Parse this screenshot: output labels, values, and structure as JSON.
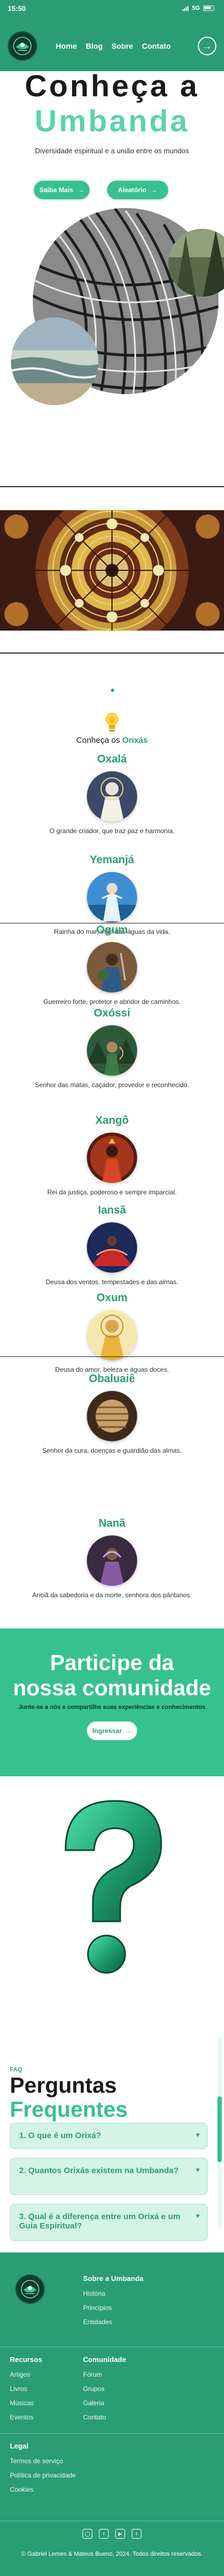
{
  "status_bar": {
    "time": "15:50",
    "network": "5G"
  },
  "header": {
    "nav": [
      "Home",
      "Blog",
      "Sobre",
      "Contato"
    ]
  },
  "hero": {
    "title_line1": "Conheça a",
    "title_line2": "Umbanda",
    "subtitle": "Diversidade espiritual e a união entre os mundos",
    "btn_primary": "Saiba Mais",
    "btn_secondary": "Aleatório"
  },
  "orixas": {
    "heading_prefix": "Conheça os ",
    "heading_highlight": "Orixás",
    "items": [
      {
        "name": "Oxalá",
        "desc": "O grande criador, que traz paz e harmonia."
      },
      {
        "name": "Yemanjá",
        "desc": "Rainha do mar, mãe das águas da vida."
      },
      {
        "name": "Ogum",
        "desc": "Guerreiro forte, protetor e abridor de caminhos."
      },
      {
        "name": "Oxóssi",
        "desc": "Senhor das matas, caçador, provedor e reconhecido."
      },
      {
        "name": "Xangô",
        "desc": "Rei da justiça, poderoso e sempre imparcial."
      },
      {
        "name": "Iansã",
        "desc": "Deusa dos ventos, tempestades e das almas."
      },
      {
        "name": "Oxum",
        "desc": "Deusa do amor, beleza e águas doces."
      },
      {
        "name": "Obaluaiê",
        "desc": "Senhor da cura, doenças e guardião das almas."
      },
      {
        "name": "Nanã",
        "desc": "Anciã da sabedoria e da morte, senhora dos pântanos."
      }
    ]
  },
  "community": {
    "title_line1": "Participe da",
    "title_line2": "nossa comunidade",
    "text": "Junte-se a nós e compartilhe suas experiências e conhecimentos",
    "button": "Ingressar"
  },
  "faq": {
    "tag": "FAQ",
    "title_line1": "Perguntas",
    "title_line2": "Frequentes",
    "items": [
      "1. O que é um Orixá?",
      "2. Quantos Orixás existem na Umbanda?",
      "3. Qual é a diferença entre um Orixá e um Guia Espiritual?"
    ]
  },
  "footer": {
    "sobre_title": "Sobre a Umbanda",
    "sobre_links": [
      "História",
      "Princípios",
      "Entidades"
    ],
    "recursos_title": "Recursos",
    "recursos_links": [
      "Artigos",
      "Livros",
      "Músicas",
      "Eventos"
    ],
    "comunidade_title": "Comunidade",
    "comunidade_links": [
      "Fórum",
      "Grupos",
      "Galeria",
      "Contato"
    ],
    "legal_title": "Legal",
    "legal_links": [
      "Termos de serviço",
      "Política de privacidade",
      "Cookies"
    ],
    "copyright": "© Gabriel Lemes & Mateus Bueno, 2024. Todos direitos reservados."
  },
  "colors": {
    "primary": "#2a9d75",
    "accent": "#36c18f",
    "light": "#d3f4e6"
  }
}
